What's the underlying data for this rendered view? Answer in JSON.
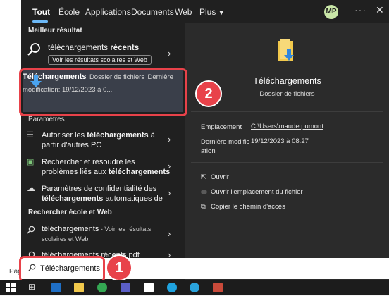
{
  "background": {
    "partial_text": "Page"
  },
  "tabs": {
    "all": "Tout",
    "school": "École",
    "apps": "Applications",
    "docs": "Documents",
    "web": "Web",
    "more": "Plus"
  },
  "header": {
    "avatar_initials": "MP",
    "more_label": "···"
  },
  "best_match": {
    "heading": "Meilleur résultat",
    "recent": {
      "title_plain": "téléchargements ",
      "title_bold": "récents",
      "pill": "Voir les résultats scolaires et Web"
    },
    "selected": {
      "title": "Téléchargements",
      "subtitle": "Dossier de fichiers",
      "modified": "Dernière modification: 19/12/2023 à 0..."
    }
  },
  "settings": {
    "heading": "Paramètres",
    "items": [
      {
        "line1_plain": "Autoriser les ",
        "line1_bold": "téléchargements",
        "line1_end": " à",
        "line2": "partir d'autres PC"
      },
      {
        "line1": "Rechercher et résoudre les",
        "line2_plain": "problèmes liés aux ",
        "line2_bold": "téléchargements"
      },
      {
        "line1": "Paramètres de confidentialité des",
        "line2_bold": "téléchargements",
        "line2_end": " automatiques de"
      }
    ]
  },
  "web_search": {
    "heading": "Rechercher école et Web",
    "items": [
      {
        "title": "téléchargements",
        "suffix": " - Voir les résultats",
        "line2": "scolaires et Web"
      },
      {
        "title": "téléchargements récents pdf"
      }
    ]
  },
  "detail": {
    "title": "Téléchargements",
    "subtitle": "Dossier de fichiers",
    "location_label": "Emplacement",
    "location_value": "C:\\Users\\maude.pumont",
    "modified_label_1": "Dernière modific",
    "modified_label_2": "ation",
    "modified_value": "19/12/2023 à 08:27",
    "actions": [
      {
        "icon": "open-icon",
        "label": "Ouvrir"
      },
      {
        "icon": "folder-icon",
        "label": "Ouvrir l'emplacement du fichier"
      },
      {
        "icon": "copy-icon",
        "label": "Copier le chemin d'accès"
      }
    ]
  },
  "search": {
    "value": "Téléchargements"
  },
  "callouts": {
    "one": "1",
    "two": "2"
  },
  "colors": {
    "accent": "#6cb8f6",
    "callout": "#e8424a",
    "panel": "#202020",
    "preview": "#2b2b2b",
    "selected": "#3a3f4a"
  }
}
